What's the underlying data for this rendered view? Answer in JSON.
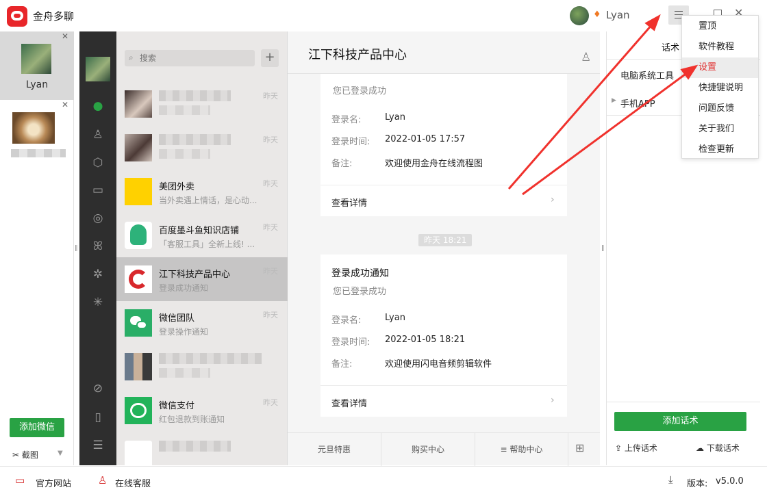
{
  "app": {
    "title": "金舟多聊",
    "user_name": "Lyan"
  },
  "accounts": [
    {
      "name": "Lyan"
    }
  ],
  "left": {
    "add_wechat": "添加微信",
    "screenshot": "截图"
  },
  "search": {
    "placeholder": "搜索"
  },
  "chats": [
    {
      "name": "",
      "msg": "",
      "time": "昨天"
    },
    {
      "name": "",
      "msg": "",
      "time": "昨天"
    },
    {
      "name": "美团外卖",
      "msg": "当外卖遇上情话，是心动...",
      "time": "昨天"
    },
    {
      "name": "百度墨斗鱼知识店铺",
      "msg": "「客服工具」全新上线! ...",
      "time": "昨天"
    },
    {
      "name": "江下科技产品中心",
      "msg": "登录成功通知",
      "time": "昨天"
    },
    {
      "name": "微信团队",
      "msg": "登录操作通知",
      "time": "昨天"
    },
    {
      "name": "",
      "msg": "",
      "time": ""
    },
    {
      "name": "微信支付",
      "msg": "红包退款到账通知",
      "time": "昨天"
    },
    {
      "name": "",
      "msg": "",
      "time": ""
    }
  ],
  "conversation": {
    "title": "江下科技产品中心",
    "card1": {
      "subtitle": "您已登录成功",
      "login_name_label": "登录名:",
      "login_name": "Lyan",
      "login_time_label": "登录时间:",
      "login_time": "2022-01-05 17:57",
      "note_label": "备注:",
      "note": "欢迎使用金舟在线流程图",
      "detail": "查看详情"
    },
    "timestamp": "昨天 18:21",
    "card2": {
      "title": "登录成功通知",
      "subtitle": "您已登录成功",
      "login_name_label": "登录名:",
      "login_name": "Lyan",
      "login_time_label": "登录时间:",
      "login_time": "2022-01-05 18:21",
      "note_label": "备注:",
      "note": "欢迎使用闪电音频剪辑软件",
      "detail": "查看详情"
    },
    "tabs": [
      "元旦特惠",
      "购买中心",
      "帮助中心"
    ]
  },
  "right_panel": {
    "tab": "话术",
    "item1": "电脑系统工具",
    "item2": "手机APP",
    "add_script": "添加话术",
    "upload": "上传话术",
    "download": "下载话术"
  },
  "menu": [
    "置顶",
    "软件教程",
    "设置",
    "快捷键说明",
    "问题反馈",
    "关于我们",
    "检查更新"
  ],
  "footer": {
    "site": "官方网站",
    "service": "在线客服",
    "version_label": "版本:",
    "version": "v5.0.0"
  },
  "colors": {
    "brand_green": "#29a244",
    "brand_red": "#e8262a",
    "arrow_red": "#f0322d"
  },
  "icons": [
    "search-icon",
    "plus-icon",
    "chat-icon",
    "contacts-icon",
    "box-icon",
    "folder-icon",
    "aperture-icon",
    "butterfly-icon",
    "settings-icon",
    "sparkle-icon",
    "link-icon",
    "phone-icon",
    "menu-icon",
    "keyboard-icon",
    "profile-icon",
    "upload-icon",
    "download-icon"
  ]
}
